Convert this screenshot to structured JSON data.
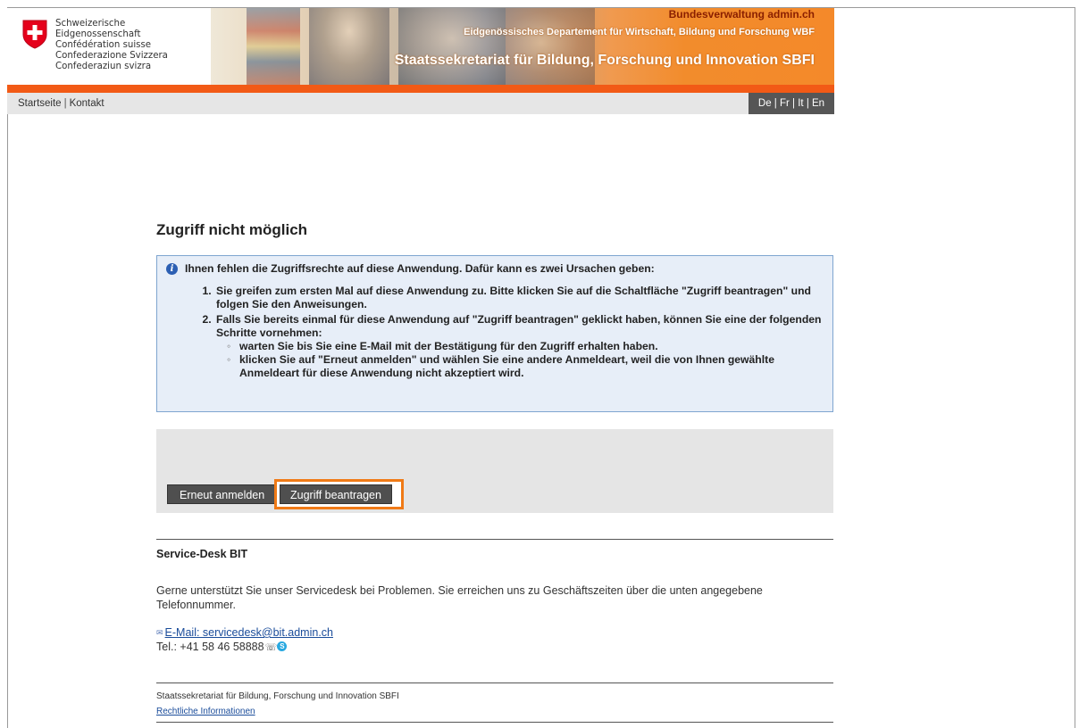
{
  "header": {
    "confederation": [
      "Schweizerische Eidgenossenschaft",
      "Confédération suisse",
      "Confederazione Svizzera",
      "Confederaziun svizra"
    ],
    "admin_link": "Bundesverwaltung admin.ch",
    "department": "Eidgenössisches Departement für Wirtschaft, Bildung und Forschung WBF",
    "secretariat": "Staatssekretariat für Bildung, Forschung und Innovation SBFI",
    "brand_color": "#f25a16"
  },
  "nav": {
    "home": "Startseite",
    "separator": "|",
    "contact": "Kontakt",
    "languages": [
      "De",
      "Fr",
      "It",
      "En"
    ]
  },
  "main": {
    "title": "Zugriff nicht möglich",
    "info": {
      "icon": "info-icon",
      "lead": "Ihnen fehlen die Zugriffsrechte auf diese Anwendung. Dafür kann es zwei Ursachen geben:",
      "step1": "Sie greifen zum ersten Mal auf diese Anwendung zu. Bitte klicken Sie auf die Schaltfläche \"Zugriff beantragen\" und folgen Sie den Anweisungen.",
      "step2": "Falls Sie bereits einmal für diese Anwendung auf \"Zugriff beantragen\" geklickt haben, können Sie eine der folgenden Schritte vornehmen:",
      "substeps": [
        "warten Sie bis Sie eine E-Mail mit der Bestätigung für den Zugriff erhalten haben.",
        "klicken Sie auf \"Erneut anmelden\" und wählen Sie eine andere Anmeldeart, weil die von Ihnen gewählte Anmeldeart für diese Anwendung nicht akzeptiert wird."
      ]
    },
    "buttons": {
      "relogin": "Erneut anmelden",
      "request": "Zugriff beantragen",
      "highlight_color": "#f07a16"
    }
  },
  "service_desk": {
    "title": "Service-Desk BIT",
    "text": "Gerne unterstützt Sie unser Servicedesk bei Problemen. Sie erreichen uns zu Geschäftszeiten über die unten angegebene Telefonnummer.",
    "email_label": "E-Mail: servicedesk@bit.admin.ch",
    "tel": "Tel.: +41 58 46 58888"
  },
  "footer": {
    "org": "Staatssekretariat für Bildung, Forschung und Innovation SBFI",
    "legal": "Rechtliche Informationen"
  }
}
